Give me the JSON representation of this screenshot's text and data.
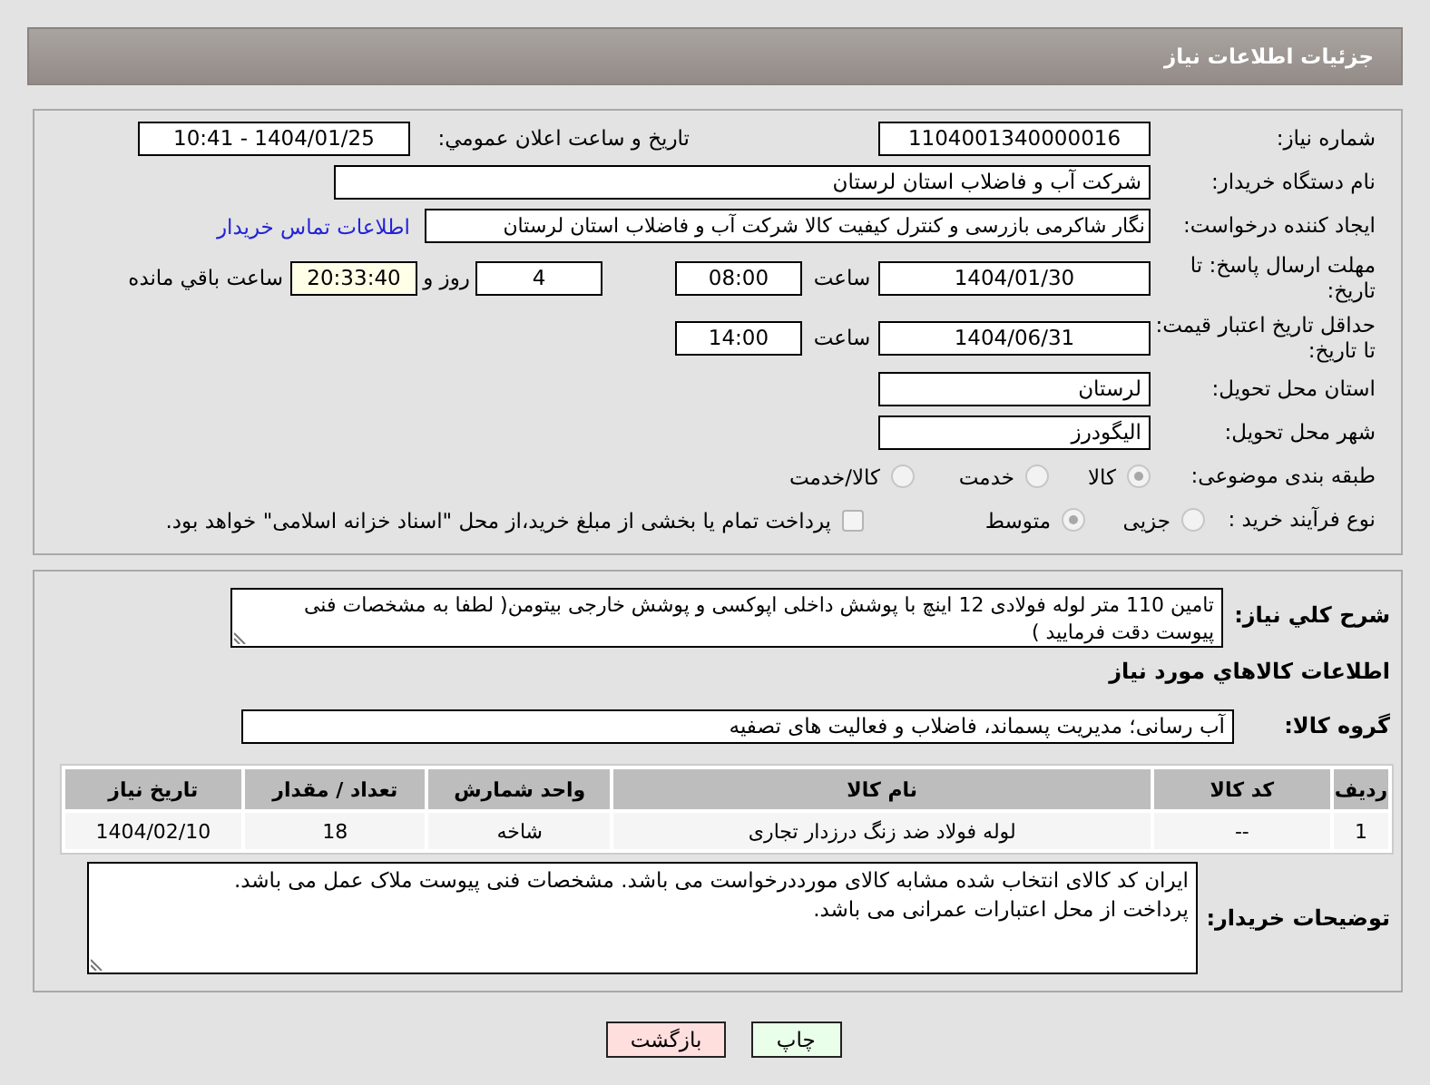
{
  "header": {
    "title": "جزئیات اطلاعات نیاز"
  },
  "details": {
    "need_number": {
      "label": "شماره نیاز:",
      "value": "1104001340000016"
    },
    "announce": {
      "label": "تاریخ و ساعت اعلان عمومي:",
      "value": "1404/01/25 - 10:41"
    },
    "buyer": {
      "label": "نام دستگاه خریدار:",
      "value": "شرکت آب و فاضلاب استان لرستان"
    },
    "requester": {
      "label": "ایجاد کننده درخواست:",
      "value": "نگار شاکرمی بازرسی و کنترل کیفیت کالا شرکت آب و فاضلاب استان لرستان",
      "link": "اطلاعات تماس خریدار"
    },
    "deadline": {
      "label": "مهلت ارسال پاسخ: تا تاریخ:",
      "date": "1404/01/30",
      "time_label": "ساعت",
      "time": "08:00",
      "days": "4",
      "days_label": "روز و",
      "remaining": "20:33:40",
      "remaining_label": "ساعت باقي مانده"
    },
    "validity": {
      "label": "حداقل تاریخ اعتبار قیمت: تا تاریخ:",
      "date": "1404/06/31",
      "time_label": "ساعت",
      "time": "14:00"
    },
    "province": {
      "label": "استان محل تحویل:",
      "value": "لرستان"
    },
    "city": {
      "label": "شهر محل تحویل:",
      "value": "الیگودرز"
    },
    "category": {
      "label": "طبقه بندی موضوعی:",
      "options": [
        {
          "label": "كالا",
          "selected": true
        },
        {
          "label": "خدمت",
          "selected": false
        },
        {
          "label": "كالا/خدمت",
          "selected": false
        }
      ]
    },
    "process": {
      "label": "نوع فرآیند خرید :",
      "options": [
        {
          "label": "جزیی",
          "selected": false
        },
        {
          "label": "متوسط",
          "selected": true
        }
      ],
      "treasury": {
        "label": "پرداخت تمام یا بخشی از مبلغ خرید،از محل \"اسناد خزانه اسلامی\" خواهد بود.",
        "checked": false
      }
    }
  },
  "description": {
    "label": "شرح کلي نياز:",
    "value": "تامین 110 متر لوله فولادی 12 اینچ با پوشش داخلی اپوکسی و پوشش خارجی بیتومن( لطفا به مشخصات فنی پیوست دقت فرمایید )"
  },
  "items": {
    "title": "اطلاعات کالاهاي مورد نياز",
    "group_label": "گروه کالا:",
    "group": "آب رسانی؛ مدیریت پسماند، فاضلاب و فعالیت های تصفیه",
    "columns": [
      "رديف",
      "کد کالا",
      "نام کالا",
      "واحد شمارش",
      "تعداد / مقدار",
      "تاريخ نياز"
    ],
    "rows": [
      [
        "1",
        "--",
        "لوله فولاد ضد زنگ درزدار تجاری",
        "شاخه",
        "18",
        "1404/02/10"
      ]
    ]
  },
  "notes": {
    "label": "توضیحات خریدار:",
    "lines": [
      "ایران کد کالای انتخاب شده مشابه کالای مورددرخواست می باشد. مشخصات فنی پیوست ملاک عمل می باشد.",
      "پرداخت از محل اعتبارات عمرانی می باشد."
    ]
  },
  "buttons": [
    {
      "label": "چاپ",
      "kind": "print"
    },
    {
      "label": "بازگشت",
      "kind": "back"
    }
  ]
}
